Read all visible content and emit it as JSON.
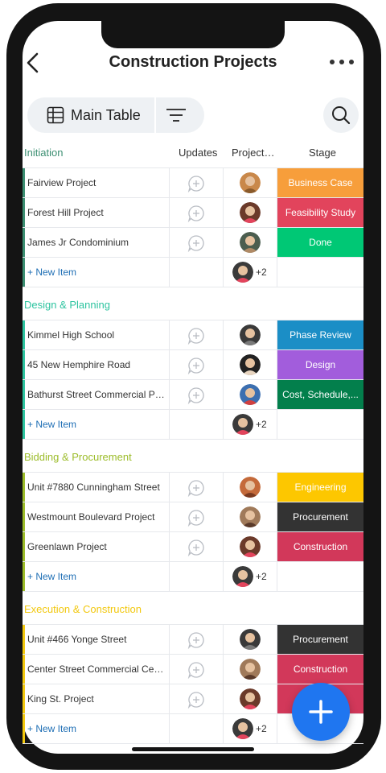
{
  "header": {
    "title": "Construction Projects"
  },
  "toolbar": {
    "main_table_label": "Main Table"
  },
  "columns": {
    "name": "",
    "updates": "Updates",
    "people": "Project…",
    "stage": "Stage"
  },
  "groups": [
    {
      "title": "Initiation",
      "color": "#3c8f72",
      "items": [
        {
          "name": "Fairview Project",
          "stage": "Business Case",
          "stage_color": "#f79e3b"
        },
        {
          "name": "Forest Hill Project",
          "stage": "Feasibility Study",
          "stage_color": "#e2445c"
        },
        {
          "name": "James Jr Condominium",
          "stage": "Done",
          "stage_color": "#00c875"
        }
      ],
      "new_item": "+ New Item",
      "more_count": "+2"
    },
    {
      "title": "Design & Planning",
      "color": "#2ec4a0",
      "items": [
        {
          "name": "Kimmel High School",
          "stage": "Phase Review",
          "stage_color": "#1b8ec6"
        },
        {
          "name": "45 New Hemphire Road",
          "stage": "Design",
          "stage_color": "#a25ddc"
        },
        {
          "name": "Bathurst Street Commercial Pr...",
          "stage": "Cost, Schedule,...",
          "stage_color": "#037f4c"
        }
      ],
      "new_item": "+ New Item",
      "more_count": "+2"
    },
    {
      "title": "Bidding & Procurement",
      "color": "#9cbc2a",
      "items": [
        {
          "name": "Unit #7880 Cunningham Street",
          "stage": "Engineering",
          "stage_color": "#fdc700"
        },
        {
          "name": "Westmount Boulevard Project",
          "stage": "Procurement",
          "stage_color": "#333333"
        },
        {
          "name": "Greenlawn Project",
          "stage": "Construction",
          "stage_color": "#d2385a"
        }
      ],
      "new_item": "+ New Item",
      "more_count": "+2"
    },
    {
      "title": "Execution & Construction",
      "color": "#f2c80f",
      "items": [
        {
          "name": "Unit #466 Yonge Street",
          "stage": "Procurement",
          "stage_color": "#333333"
        },
        {
          "name": "Center Street Commercial Cent...",
          "stage": "Construction",
          "stage_color": "#d2385a"
        },
        {
          "name": "King St. Project",
          "stage": "",
          "stage_color": "#d2385a"
        }
      ],
      "new_item": "+ New Item",
      "more_count": "+2"
    }
  ],
  "icons": {
    "back": "chevron-left-icon",
    "more": "more-horizontal-icon",
    "table": "table-icon",
    "filter": "filter-icon",
    "search": "search-icon",
    "updates": "add-update-icon",
    "fab": "plus-icon"
  }
}
